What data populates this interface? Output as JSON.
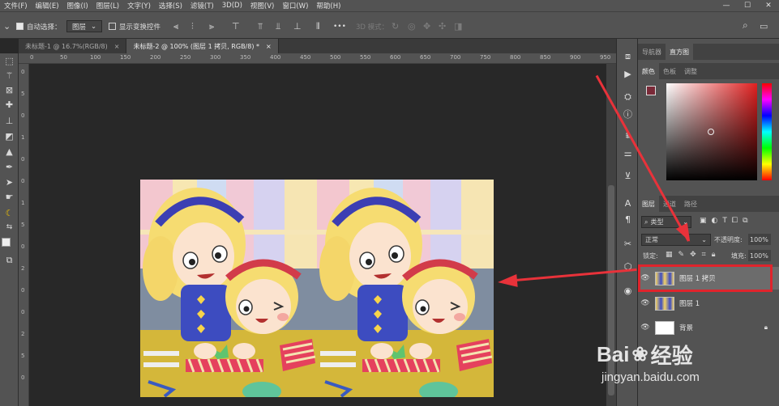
{
  "menubar": {
    "items": [
      "文件(F)",
      "编辑(E)",
      "图像(I)",
      "图层(L)",
      "文字(Y)",
      "选择(S)",
      "滤镜(T)",
      "3D(D)",
      "视图(V)",
      "窗口(W)",
      "帮助(H)"
    ],
    "minimize": "—",
    "restore": "☐",
    "close": "✕"
  },
  "options": {
    "auto_select_label": "自动选择：",
    "auto_select_target": "图层",
    "show_transform_label": "显示变换控件",
    "mode3d_label": "3D 模式：",
    "more": "•••"
  },
  "tabs": [
    {
      "label": "未标题-1 @ 16.7%(RGB/8)",
      "close": "×"
    },
    {
      "label": "未标题-2 @ 100% (图层 1 拷贝, RGB/8) *",
      "close": "×"
    }
  ],
  "ruler": {
    "top": [
      "0",
      "50",
      "100",
      "150",
      "200",
      "250",
      "300",
      "350",
      "400",
      "450",
      "500",
      "550",
      "600",
      "650",
      "700",
      "750",
      "800",
      "850",
      "900",
      "950"
    ],
    "left": [
      "0",
      "5",
      "0",
      "1",
      "0",
      "0",
      "1",
      "5",
      "0",
      "2",
      "0",
      "0",
      "2",
      "5",
      "0"
    ]
  },
  "panels": {
    "nav_tabs": [
      "导航器",
      "直方图"
    ],
    "color_tabs": [
      "颜色",
      "色板",
      "调整"
    ],
    "foreground_color": "#7a2a38",
    "layer_tabs": [
      "图层",
      "通道",
      "路径"
    ],
    "filter_label": "类型",
    "blend_mode": "正常",
    "opacity_label": "不透明度:",
    "opacity_value": "100%",
    "lock_label": "锁定:",
    "fill_label": "填充:",
    "fill_value": "100%",
    "layers": [
      {
        "name": "图层 1 拷贝",
        "selected": true
      },
      {
        "name": "图层 1",
        "selected": false
      },
      {
        "name": "背景",
        "selected": false
      }
    ]
  },
  "watermark": {
    "brand": "Bai",
    "brand_suffix": "经验",
    "url": "jingyan.baidu.com"
  },
  "colors": {
    "accent_red": "#e8323a",
    "highlight_box": "#e0242c",
    "ui_bg": "#535353"
  }
}
